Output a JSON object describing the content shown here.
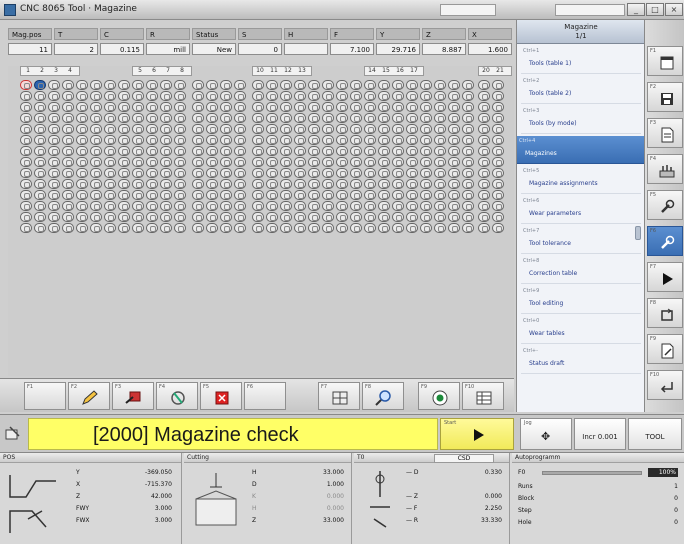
{
  "titlebar": {
    "title": "CNC 8065 Tool · Magazine",
    "minimize": "_",
    "maximize": "□",
    "close": "×"
  },
  "coord_header": {
    "labels": [
      "Mag.pos",
      "T",
      "C",
      "R",
      "Status",
      "S",
      "H",
      "F",
      "Y",
      "Z",
      "X"
    ],
    "values": [
      "11",
      "2",
      "0.115",
      "mill",
      "New",
      "0",
      "",
      "7.100",
      "29.716",
      "8.887",
      "1.600"
    ]
  },
  "magazine": {
    "groups": [
      {
        "header": [
          "1",
          "2",
          "3",
          "4"
        ]
      },
      {
        "header": [
          "5",
          "6",
          "7",
          "8"
        ]
      },
      {
        "header": [
          "10",
          "11",
          "12",
          "13"
        ]
      },
      {
        "header": [
          "14",
          "15",
          "16",
          "17"
        ]
      },
      {
        "header": [
          "20",
          "21"
        ]
      }
    ]
  },
  "toolbar": {
    "buttons": [
      {
        "key": "F1",
        "icon": "blank-icon"
      },
      {
        "key": "F2",
        "icon": "pencil-icon"
      },
      {
        "key": "F3",
        "icon": "tool-insert-icon"
      },
      {
        "key": "F4",
        "icon": "tool-holder-icon"
      },
      {
        "key": "F5",
        "icon": "delete-icon"
      },
      {
        "key": "F6",
        "icon": "blank-icon"
      },
      {
        "key": "F7",
        "icon": "magazine-icon"
      },
      {
        "key": "F8",
        "icon": "search-icon"
      },
      {
        "key": "F9",
        "icon": "record-icon"
      },
      {
        "key": "F10",
        "icon": "table-icon"
      }
    ]
  },
  "right_panel": {
    "header_line1": "Magazine",
    "header_line2": "1/1",
    "items": [
      {
        "key": "Ctrl+1",
        "label": "Tools (table 1)"
      },
      {
        "key": "Ctrl+2",
        "label": "Tools (table 2)"
      },
      {
        "key": "Ctrl+3",
        "label": "Tools (by mode)"
      },
      {
        "key": "Ctrl+4",
        "label": "Magazines",
        "selected": true
      },
      {
        "key": "Ctrl+5",
        "label": "Magazine assignments"
      },
      {
        "key": "Ctrl+6",
        "label": "Wear parameters"
      },
      {
        "key": "Ctrl+7",
        "label": "Tool tolerance"
      },
      {
        "key": "Ctrl+8",
        "label": "Correction table"
      },
      {
        "key": "Ctrl+9",
        "label": "Tool editing"
      },
      {
        "key": "Ctrl+0",
        "label": "Wear tables"
      },
      {
        "key": "Ctrl+-",
        "label": "Status draft"
      }
    ]
  },
  "side_column": {
    "buttons": [
      {
        "key": "F1",
        "icon": "window-icon"
      },
      {
        "key": "F2",
        "icon": "save-icon"
      },
      {
        "key": "F3",
        "icon": "document-icon"
      },
      {
        "key": "F4",
        "icon": "tools-icon"
      },
      {
        "key": "F5",
        "icon": "wrench-icon"
      },
      {
        "key": "F6",
        "icon": "tool-view-icon",
        "active": true
      },
      {
        "key": "F7",
        "icon": "play-icon"
      },
      {
        "key": "F8",
        "icon": "cycle-icon"
      },
      {
        "key": "F9",
        "icon": "edit-doc-icon"
      },
      {
        "key": "F10",
        "icon": "return-icon"
      }
    ]
  },
  "message": {
    "text": "[2000] Magazine check",
    "start_key": "Start",
    "buttons": [
      {
        "key": "Jog",
        "icon": "✥",
        "label": ""
      },
      {
        "key": "",
        "icon": "",
        "label": "Incr 0.001"
      },
      {
        "key": "",
        "icon": "",
        "label": "TOOL"
      }
    ]
  },
  "status": {
    "pos_title": "POS",
    "pos_rows": [
      {
        "axis": "Y",
        "value": "-369.050"
      },
      {
        "axis": "X",
        "value": "-715.370"
      },
      {
        "axis": "Z",
        "value": "42.000"
      },
      {
        "axis": "FWY",
        "value": "3.000"
      },
      {
        "axis": "FWX",
        "value": "3.000"
      }
    ],
    "cut_title": "Cutting",
    "cut_rows": [
      {
        "label": "H",
        "value": "33.000"
      },
      {
        "label": "D",
        "value": "1.000"
      },
      {
        "label": "K",
        "value": "0.000"
      },
      {
        "label": "H",
        "value": "0.000"
      },
      {
        "label": "Z",
        "value": "33.000"
      }
    ],
    "t_title": "T0",
    "csd": "CSD",
    "t_rows": [
      {
        "label": "D",
        "value": "0.330"
      },
      {
        "label": "Z",
        "value": "0.000"
      },
      {
        "label": "F",
        "value": "2.250"
      },
      {
        "label": "R",
        "value": "33.330"
      }
    ],
    "auto_title": "Autoprogramm",
    "feed_label": "F0",
    "feed_value": "100%",
    "auto_rows": [
      {
        "label": "Runs",
        "value": "1"
      },
      {
        "label": "Block",
        "value": "0"
      },
      {
        "label": "Step",
        "value": "0"
      },
      {
        "label": "Hole",
        "value": "0"
      }
    ]
  }
}
